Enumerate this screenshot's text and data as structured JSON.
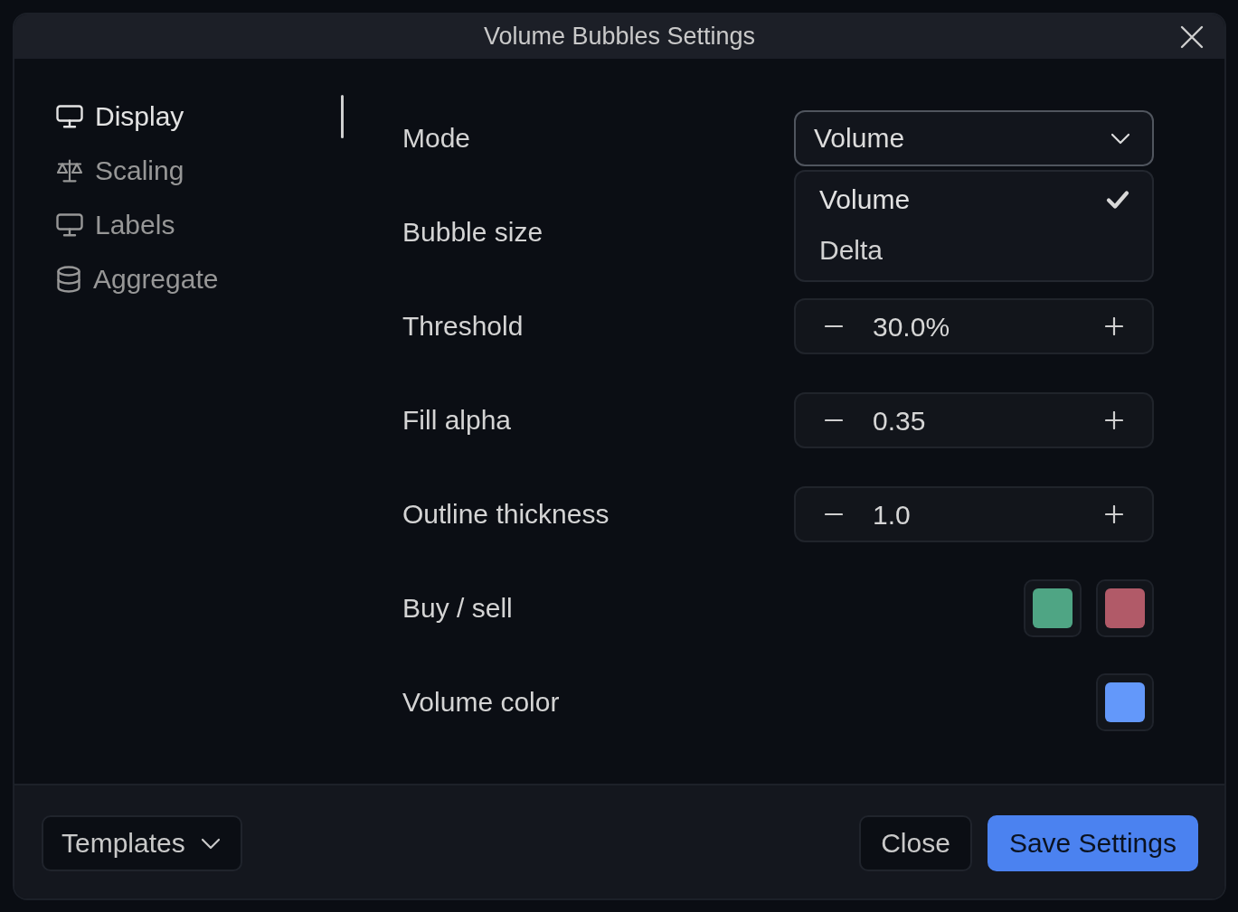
{
  "window": {
    "title": "Volume Bubbles Settings"
  },
  "sidebar": {
    "items": [
      {
        "label": "Display",
        "selected": true
      },
      {
        "label": "Scaling",
        "selected": false
      },
      {
        "label": "Labels",
        "selected": false
      },
      {
        "label": "Aggregate",
        "selected": false
      }
    ]
  },
  "settings": [
    {
      "kind": "dropdown",
      "label": "Mode",
      "value": "Volume",
      "expanded": true,
      "options": [
        {
          "label": "Volume",
          "selected": true
        },
        {
          "label": "Delta",
          "selected": false
        }
      ]
    },
    {
      "kind": "label",
      "label": "Bubble size"
    },
    {
      "kind": "stepper",
      "label": "Threshold",
      "value": "30.0%"
    },
    {
      "kind": "stepper",
      "label": "Fill alpha",
      "value": "0.35"
    },
    {
      "kind": "stepper",
      "label": "Outline thickness",
      "value": "1.0"
    },
    {
      "kind": "colors",
      "label": "Buy / sell",
      "colors": [
        {
          "color": "#4fa584"
        },
        {
          "color": "#b15a68"
        }
      ]
    },
    {
      "kind": "colors",
      "label": "Volume color",
      "colors": [
        {
          "color": "#6398fa"
        }
      ]
    }
  ],
  "footer": {
    "templates": "Templates",
    "buttons": [
      {
        "label": "Close",
        "kind": "secondary"
      },
      {
        "label": "Save Settings",
        "kind": "primary"
      }
    ]
  }
}
